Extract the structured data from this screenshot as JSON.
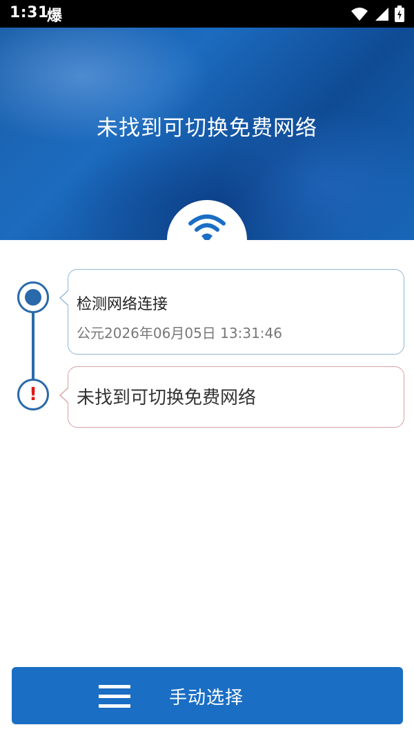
{
  "status_bar": {
    "time": "1:31",
    "app_glyph": "爆",
    "icons": [
      "wifi-icon",
      "signal-icon",
      "battery-icon"
    ]
  },
  "header": {
    "title": "未找到可切换免费网络",
    "badge_icon": "wifi-icon"
  },
  "timeline": {
    "steps": [
      {
        "title": "检测网络连接",
        "time": "公元2026年06月05日 13:31:46",
        "icon": "dot-icon"
      },
      {
        "title": "未找到可切换免费网络",
        "icon": "exclamation-icon",
        "mark": "!"
      }
    ]
  },
  "footer": {
    "button_label": "手动选择",
    "button_icon": "menu-icon"
  },
  "colors": {
    "primary": "#1a6ec4",
    "timeline": "#2a6aaa",
    "error": "#e01818"
  }
}
